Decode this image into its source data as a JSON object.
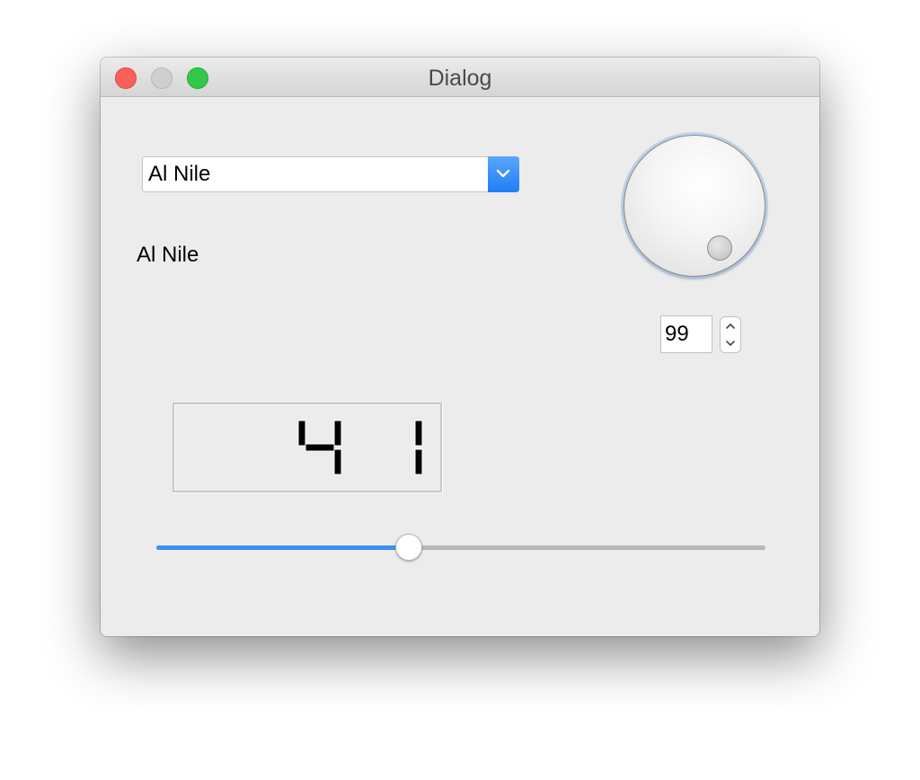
{
  "window": {
    "title": "Dialog",
    "buttons": [
      "close",
      "minimize",
      "zoom"
    ]
  },
  "font_combo": {
    "selected": "Al Nile",
    "arrow_icon": "chevron-down-icon"
  },
  "font_label": {
    "text": "Al Nile"
  },
  "dial": {
    "value": 99
  },
  "spinbox": {
    "value": "99",
    "up_icon": "chevron-up-icon",
    "down_icon": "chevron-down-icon"
  },
  "lcd": {
    "value": "41"
  },
  "slider": {
    "min": 0,
    "max": 99,
    "value": 41
  },
  "colors": {
    "accent": "#3b8ff5",
    "close": "#fc605b",
    "minimize": "#cfcfcf",
    "zoom": "#34c84a"
  }
}
